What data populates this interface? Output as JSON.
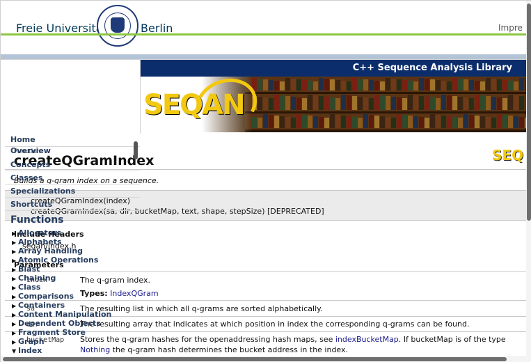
{
  "fu_header": {
    "name_left": "Freie Universität",
    "name_right": "Berlin",
    "impressum": "Impre"
  },
  "banner": {
    "title": "C++ Sequence Analysis Library",
    "logo": "SEQAN"
  },
  "nav": {
    "links": [
      "Home",
      "Overview",
      "Concepts",
      "Classes",
      "Specializations",
      "Shortcuts"
    ],
    "functions_heading": "Functions",
    "function_groups": [
      "Allocators",
      "Alphabets",
      "Array Handling",
      "Atomic Operations",
      "Blast",
      "Chaining",
      "Class",
      "Comparisons",
      "Containers",
      "Content Manipulation",
      "Dependent Objects",
      "Fragment Store",
      "Graph",
      "Index"
    ],
    "expanded_group": "Index",
    "cut_off_item": "Shortcuts"
  },
  "page": {
    "kind": "Function",
    "logo_small": "SEQ",
    "title": "createQGramIndex",
    "summary": "Builds a q-gram index on a sequence.",
    "signatures": [
      "createQGramIndex(index)",
      "createQGramIndex(sa, dir, bucketMap, text, shape, stepSize) [DEPRECATED]"
    ],
    "include_heading": "Include Headers",
    "include_file": "seqan/index.h",
    "params_heading": "Parameters",
    "params": [
      {
        "name": "index",
        "text": "The q-gram index.",
        "types_label": "Types:",
        "types_value": "IndexQGram"
      },
      {
        "name": "sa",
        "text": "The resulting list in which all q-grams are sorted alphabetically."
      },
      {
        "name": "dir",
        "text": "The resulting array that indicates at which position in index the corresponding q-grams can be found."
      },
      {
        "name": "bucketMap",
        "text_before": "Stores the q-gram hashes for the openaddressing hash maps, see",
        "link": "indexBucketMap",
        "text_after": ". If bucketMap is of the type",
        "link2": "Nothing",
        "text_end": "the q-gram hash determines the bucket address in the index."
      }
    ]
  },
  "colors": {
    "fu_blue": "#00395a",
    "fu_green": "#8cc63f",
    "banner_blue": "#0b2d6b",
    "seqan_yellow": "#f2c811",
    "link": "#1a1a8c"
  }
}
